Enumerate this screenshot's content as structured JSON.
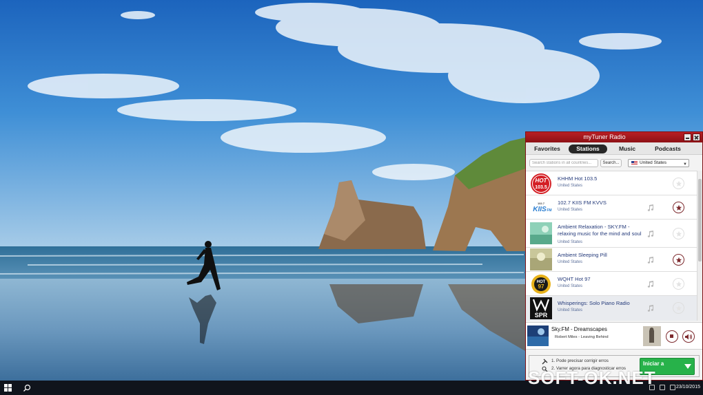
{
  "window": {
    "title": "myTuner Radio"
  },
  "tabs": [
    {
      "label": "Favorites"
    },
    {
      "label": "Stations"
    },
    {
      "label": "Music"
    },
    {
      "label": "Podcasts"
    }
  ],
  "search": {
    "placeholder": "Search stations in all countries...",
    "button_label": "Search..."
  },
  "country_select": {
    "selected": "United States"
  },
  "stations": [
    {
      "name": "KHHM Hot 103.5",
      "country": "United States",
      "favorite": false,
      "logo_text": "HOT 103.5"
    },
    {
      "name": "102.7 KIIS FM KVVS",
      "country": "United States",
      "favorite": true,
      "logo_text": "KIIS FM"
    },
    {
      "name": "Ambient Relaxation - SKY.FM - relaxing music for the mind and soul",
      "country": "United States",
      "favorite": false,
      "logo_text": ""
    },
    {
      "name": "Ambient Sleeping Pill",
      "country": "United States",
      "favorite": true,
      "logo_text": ""
    },
    {
      "name": "WQHT Hot 97",
      "country": "United States",
      "favorite": false,
      "logo_text": "HOT 97"
    },
    {
      "name": "Whisperings: Solo Piano Radio",
      "country": "United States",
      "favorite": false,
      "logo_text": "SPR"
    }
  ],
  "now_playing": {
    "station": "Sky.FM - Dreamscapes",
    "track": "Robert Miles - Leaving Behind"
  },
  "ad": {
    "line1": "1. Pode precisar corrigir erros",
    "line2": "2. Varrer agora para diagnosticar erros",
    "cta_label": "Iniciar a"
  },
  "taskbar": {
    "date": "23/10/2015"
  },
  "watermark": "SOFT-OK.NET",
  "colors": {
    "accent": "#a3171c",
    "title_text": "#ffffff",
    "station_name": "#243a7a",
    "ad_button": "#27b24a"
  }
}
